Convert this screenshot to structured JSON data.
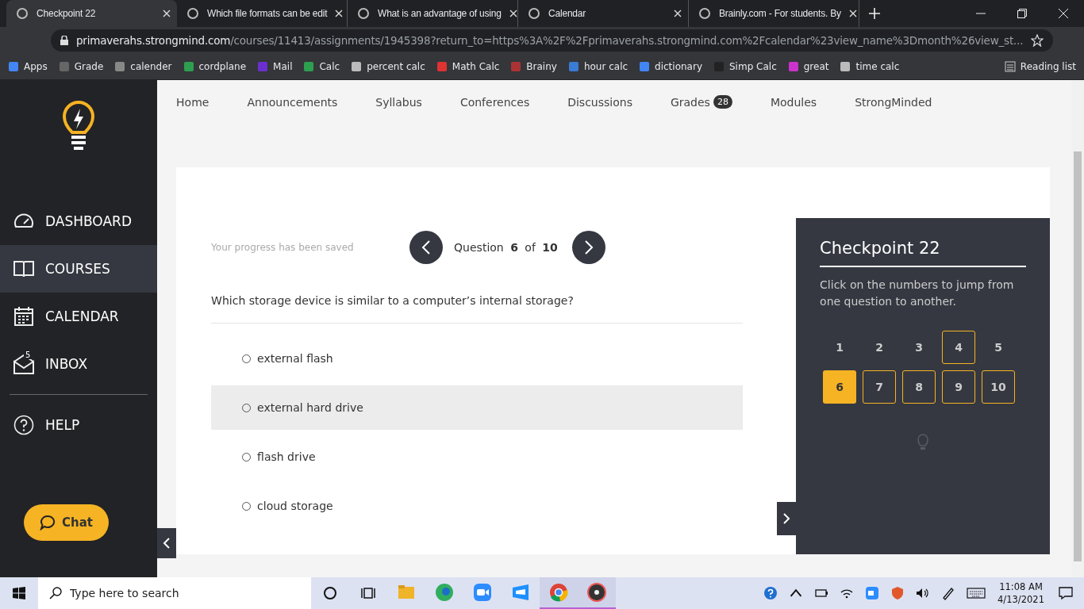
{
  "browser": {
    "tabs": [
      {
        "title": "Checkpoint 22",
        "selected": true
      },
      {
        "title": "Which file formats can be edit",
        "selected": false
      },
      {
        "title": "What is an advantage of using",
        "selected": false
      },
      {
        "title": "Calendar",
        "selected": false
      },
      {
        "title": "Brainly.com - For students. By",
        "selected": false
      }
    ],
    "url_host": "primaverahs.strongmind.com",
    "url_rest": "/courses/11413/assignments/1945398?return_to=https%3A%2F%2Fprimaverahs.strongmind.com%2Fcalendar%23view_name%3Dmonth%26view_st...",
    "bookmarks": [
      "Apps",
      "Grade",
      "calender",
      "cordplane",
      "Mail",
      "Calc",
      "percent calc",
      "Math Calc",
      "Brainy",
      "hour calc",
      "dictionary",
      "Simp Calc",
      "great",
      "time calc"
    ],
    "reading_list": "Reading list"
  },
  "sidebar": {
    "items": [
      {
        "label": "DASHBOARD",
        "selected": false
      },
      {
        "label": "COURSES",
        "selected": true
      },
      {
        "label": "CALENDAR",
        "selected": false
      },
      {
        "label": "INBOX",
        "selected": false,
        "badge": "5"
      },
      {
        "label": "HELP",
        "selected": false
      }
    ],
    "chat": "Chat"
  },
  "course_nav": [
    {
      "label": "Home"
    },
    {
      "label": "Announcements"
    },
    {
      "label": "Syllabus"
    },
    {
      "label": "Conferences"
    },
    {
      "label": "Discussions"
    },
    {
      "label": "Grades",
      "badge": "28"
    },
    {
      "label": "Modules"
    },
    {
      "label": "StrongMinded"
    }
  ],
  "quiz": {
    "saved_note": "Your progress has been saved",
    "question_word": "Question",
    "current": "6",
    "of_word": "of",
    "total": "10",
    "question": "Which storage device is similar to a computer’s internal storage?",
    "answers": [
      {
        "text": "external flash",
        "selected": false,
        "hovered": false
      },
      {
        "text": "external hard drive",
        "selected": false,
        "hovered": true
      },
      {
        "text": "flash drive",
        "selected": false,
        "hovered": false
      },
      {
        "text": "cloud storage",
        "selected": false,
        "hovered": false
      }
    ]
  },
  "checkpoint": {
    "title": "Checkpoint 22",
    "hint": "Click on the numbers to jump from one question to another.",
    "questions": [
      {
        "label": "1",
        "selected": false,
        "outlined": false
      },
      {
        "label": "2",
        "selected": false,
        "outlined": false
      },
      {
        "label": "3",
        "selected": false,
        "outlined": false
      },
      {
        "label": "4",
        "selected": false,
        "outlined": true
      },
      {
        "label": "5",
        "selected": false,
        "outlined": false
      },
      {
        "label": "6",
        "selected": true,
        "outlined": false
      },
      {
        "label": "7",
        "selected": false,
        "outlined": true
      },
      {
        "label": "8",
        "selected": false,
        "outlined": true
      },
      {
        "label": "9",
        "selected": false,
        "outlined": true
      },
      {
        "label": "10",
        "selected": false,
        "outlined": true
      }
    ]
  },
  "taskbar": {
    "search_placeholder": "Type here to search",
    "apps": [
      {
        "kind": "files",
        "running": false
      },
      {
        "kind": "edge",
        "running": false
      },
      {
        "kind": "zoom",
        "running": false
      },
      {
        "kind": "store",
        "running": false
      },
      {
        "kind": "chrome",
        "running": true
      },
      {
        "kind": "music",
        "running": true
      }
    ],
    "time": "11:08 AM",
    "date": "4/13/2021"
  }
}
